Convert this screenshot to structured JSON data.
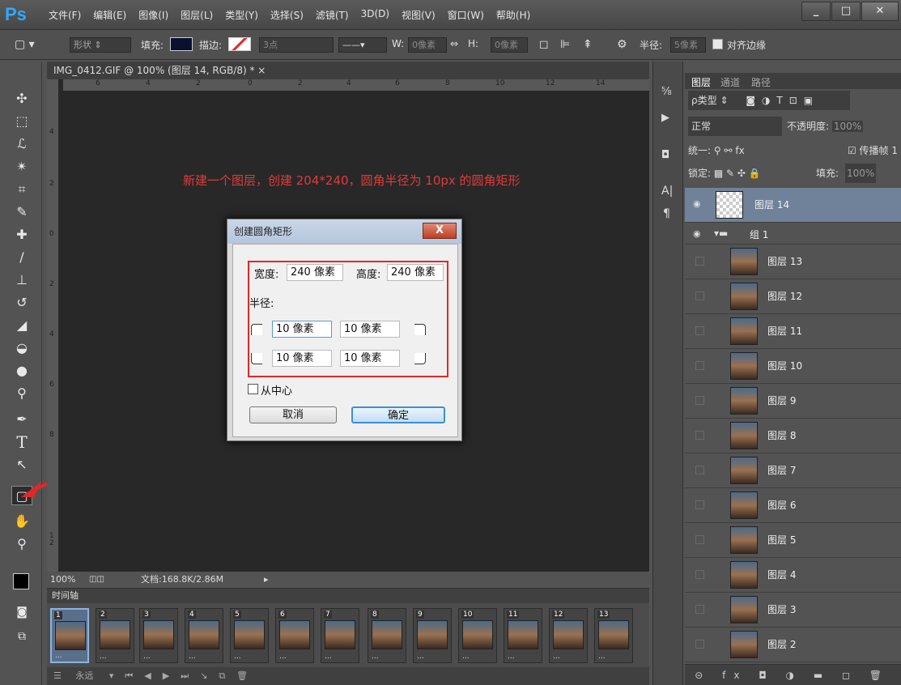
{
  "app": {
    "logo": "Ps",
    "menu": [
      "文件(F)",
      "编辑(E)",
      "图像(I)",
      "图层(L)",
      "类型(Y)",
      "选择(S)",
      "滤镜(T)",
      "3D(D)",
      "视图(V)",
      "窗口(W)",
      "帮助(H)"
    ],
    "win_min": "_",
    "win_max": "□",
    "win_close": "✕"
  },
  "options": {
    "shape_mode": "形状",
    "fill_label": "填充:",
    "stroke_label": "描边:",
    "stroke_size": "3点",
    "w_label": "W:",
    "w_value": "0像素",
    "h_label": "H:",
    "h_value": "0像素",
    "radius_label": "半径:",
    "radius_value": "5像素",
    "align_edges": "对齐边缘"
  },
  "document": {
    "tab_title": "IMG_0412.GIF @ 100% (图层 14, RGB/8) * ×",
    "hruler": [
      "6",
      "4",
      "2",
      "0",
      "2",
      "4",
      "6",
      "8",
      "10",
      "12",
      "14"
    ],
    "vruler": [
      "4",
      "2",
      "0",
      "2",
      "4",
      "6",
      "8",
      "1\n2"
    ],
    "note": "新建一个图层，创建 204*240，圆角半径为 10px 的圆角矩形",
    "zoom": "100%",
    "doc_info": "文档:168.8K/2.86M"
  },
  "timeline": {
    "title": "时间轴",
    "frames": [
      "1",
      "2",
      "3",
      "4",
      "5",
      "6",
      "7",
      "8",
      "9",
      "10",
      "11",
      "12",
      "13"
    ],
    "delay": "...",
    "loop": "永远"
  },
  "dialog": {
    "title": "创建圆角矩形",
    "close": "X",
    "width_label": "宽度:",
    "width_value": "240 像素",
    "height_label": "高度:",
    "height_value": "240 像素",
    "radius_label": "半径:",
    "r_tl": "10 像素",
    "r_tr": "10 像素",
    "r_bl": "10 像素",
    "r_br": "10 像素",
    "from_center": "从中心",
    "cancel": "取消",
    "ok": "确定"
  },
  "layers_panel": {
    "tabs": [
      "图层",
      "通道",
      "路径"
    ],
    "filter_label": "ρ类型",
    "blend_mode": "正常",
    "opacity_label": "不透明度:",
    "opacity_value": "100%",
    "unify_label": "统一:",
    "propagate": "传播帧 1",
    "lock_label": "锁定:",
    "fill_label": "填充:",
    "fill_value": "100%",
    "selected_layer": "图层 14",
    "group": "组 1",
    "layers": [
      "图层 13",
      "图层 12",
      "图层 11",
      "图层 10",
      "图层 9",
      "图层 8",
      "图层 7",
      "图层 6",
      "图层 5",
      "图层 4",
      "图层 3",
      "图层 2"
    ],
    "bottom_icons": "⊝ fx ◘ ◑ ▬ ◻ 🗑"
  },
  "colors": {
    "accent": "#31a8ff",
    "note_red": "#e03b3b",
    "highlight_box": "#e02828",
    "selected_layer_bg": "#6f8299"
  }
}
